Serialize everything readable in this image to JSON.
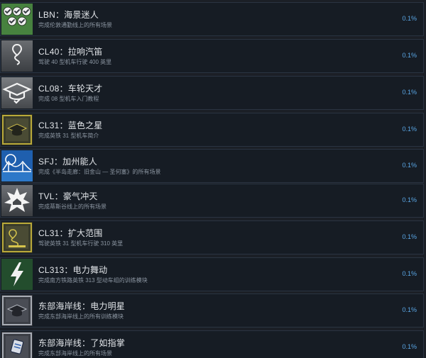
{
  "achievements": [
    {
      "title": "LBN：海景迷人",
      "description": "完成伦敦通勤线上的所有场景",
      "percent": "0.1%",
      "icon": "checkmarks-icon"
    },
    {
      "title": "CL40：拉响汽笛",
      "description": "驾驶 40 型机车行驶 400 英里",
      "percent": "0.1%",
      "icon": "route-400-icon"
    },
    {
      "title": "CL08：车轮天才",
      "description": "完成 08 型机车入门教程",
      "percent": "0.1%",
      "icon": "graduation-cap-icon"
    },
    {
      "title": "CL31：蓝色之星",
      "description": "完成英铁 31 型机车简介",
      "percent": "0.1%",
      "icon": "gold-cap-icon"
    },
    {
      "title": "SFJ：加州能人",
      "description": "完成《半岛走廊：旧金山 — 圣何塞》的所有场景",
      "percent": "0.1%",
      "icon": "bridge-icon"
    },
    {
      "title": "TVL：豪气冲天",
      "description": "完成蒂斯谷线上的所有场景",
      "percent": "0.1%",
      "icon": "star-burst-icon"
    },
    {
      "title": "CL31：扩大范围",
      "description": "驾驶英铁 31 型机车行驶 310 英里",
      "percent": "0.1%",
      "icon": "gold-route-icon"
    },
    {
      "title": "CL313：电力舞动",
      "description": "完成南方铁路英铁 313 型动车组的训练模块",
      "percent": "0.1%",
      "icon": "lightning-icon"
    },
    {
      "title": "东部海岸线：电力明星",
      "description": "完成东部海岸线上的所有训练模块",
      "percent": "0.1%",
      "icon": "silver-cap-icon"
    },
    {
      "title": "东部海岸线：了如指掌",
      "description": "完成东部海岸线上的所有场景",
      "percent": "0.1%",
      "icon": "book-icon"
    }
  ]
}
